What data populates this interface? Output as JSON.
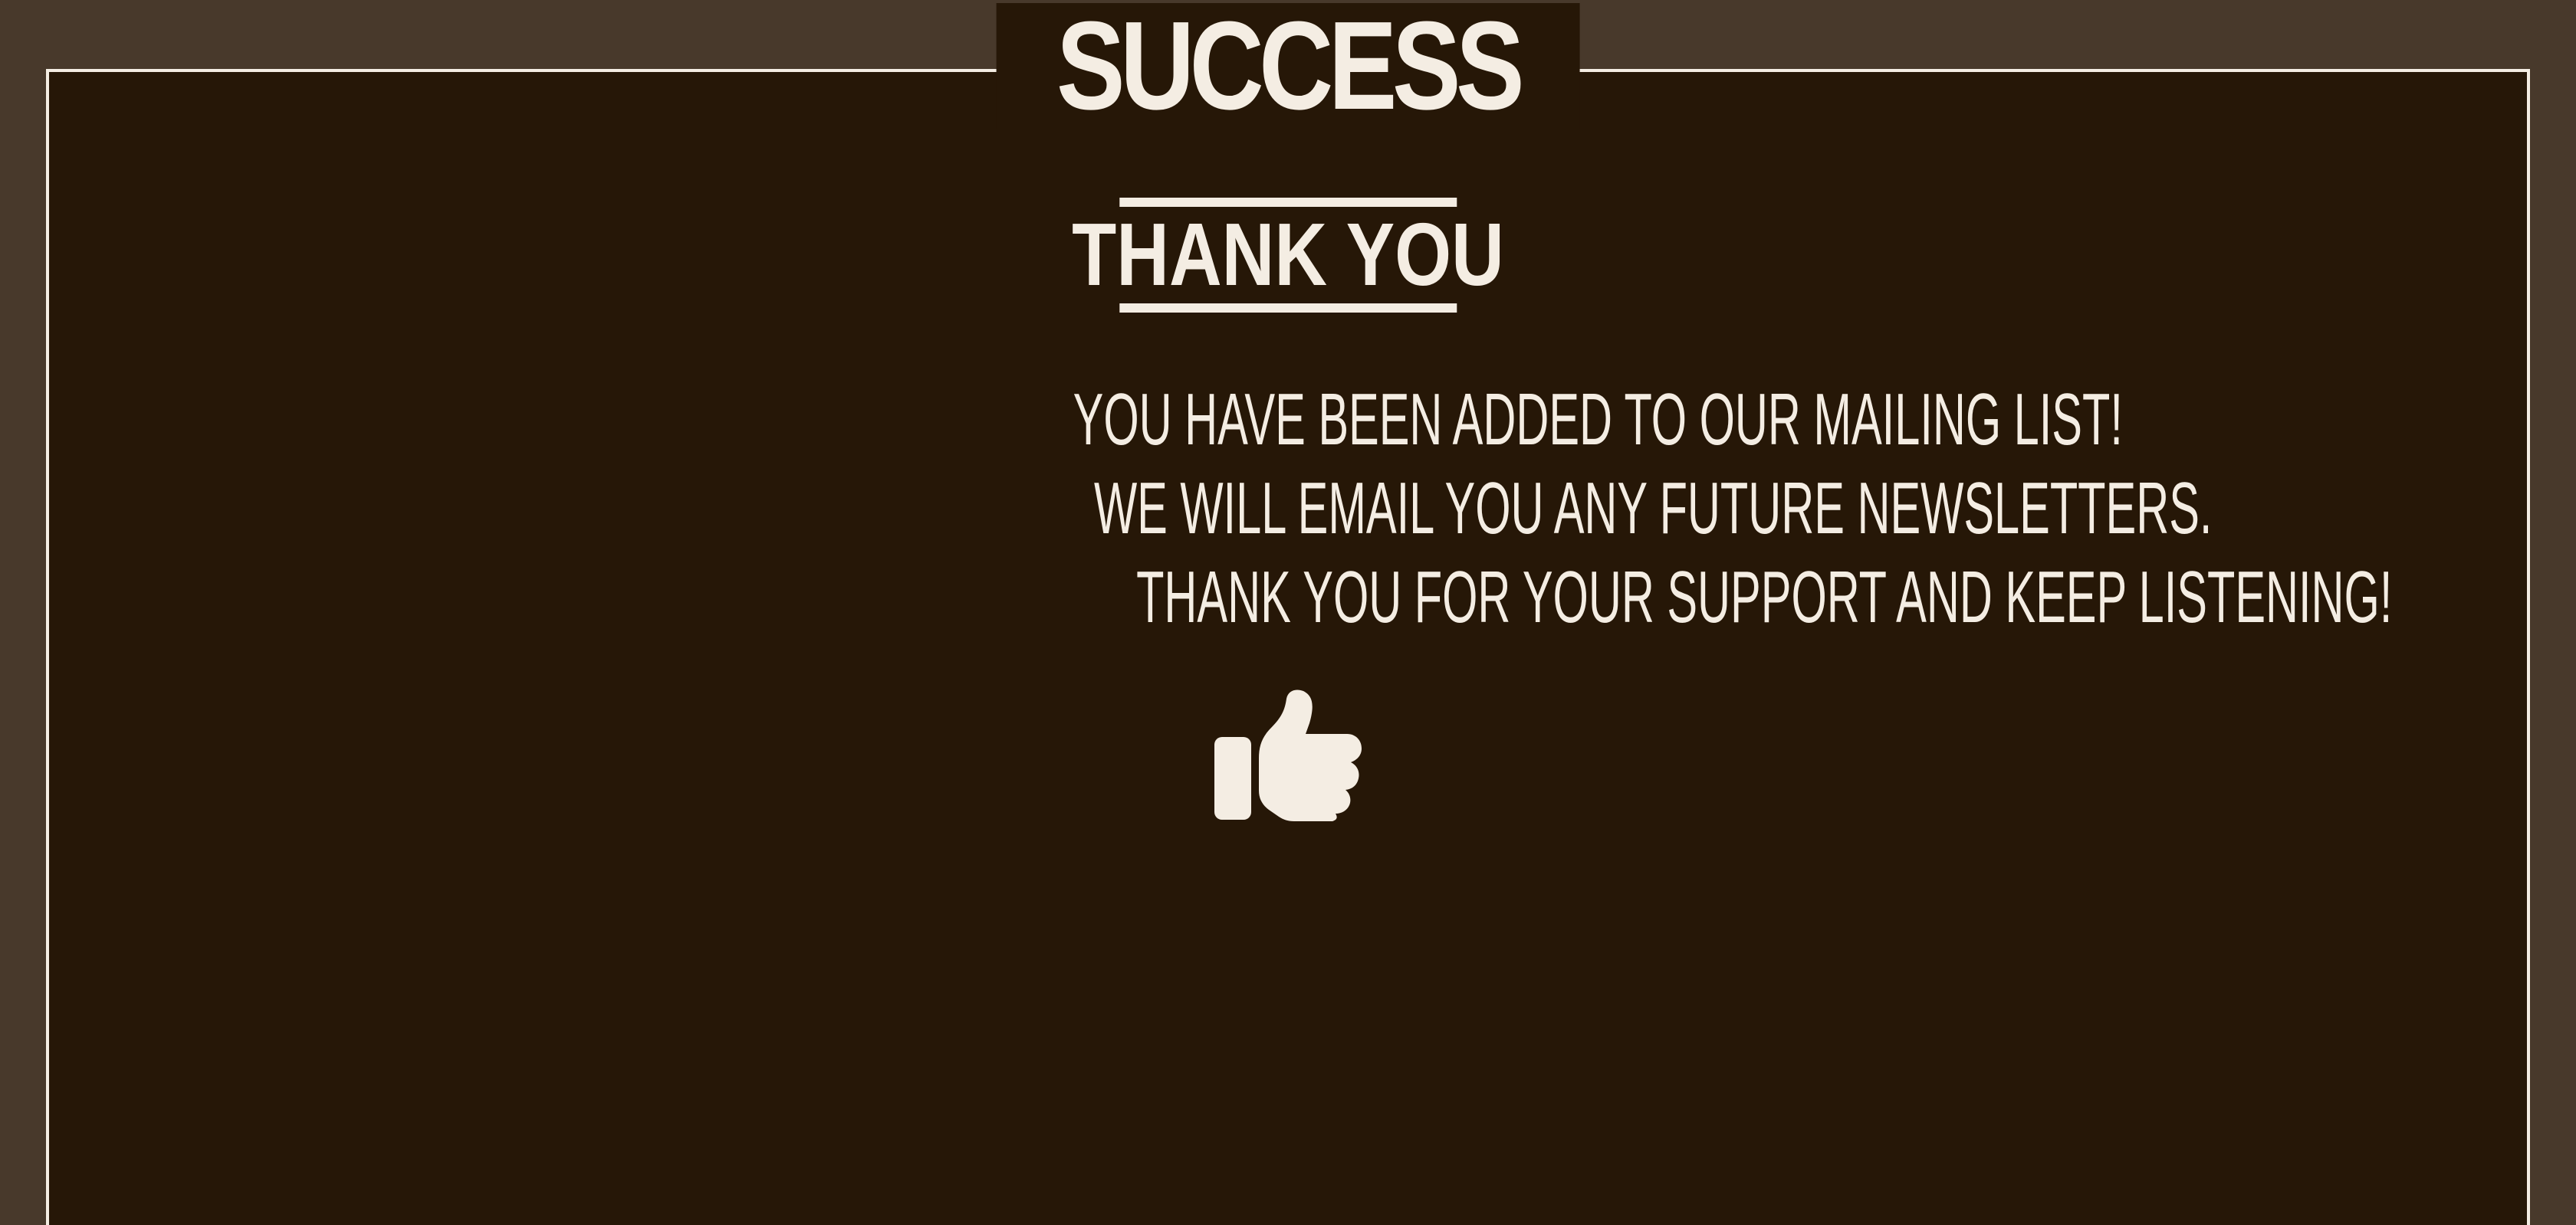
{
  "success_page": {
    "title": "SUCCESS",
    "subtitle": "THANK YOU",
    "message_lines": [
      "YOU HAVE BEEN ADDED TO OUR MAILING LIST!",
      "WE WILL EMAIL YOU ANY FUTURE NEWSLETTERS.",
      "THANK YOU FOR YOUR SUPPORT AND KEEP LISTENING!"
    ],
    "icon": "thumbs-up-icon"
  },
  "colors": {
    "outer_background": "#48392b",
    "panel_background": "#261707",
    "foreground": "#f4ede3"
  }
}
